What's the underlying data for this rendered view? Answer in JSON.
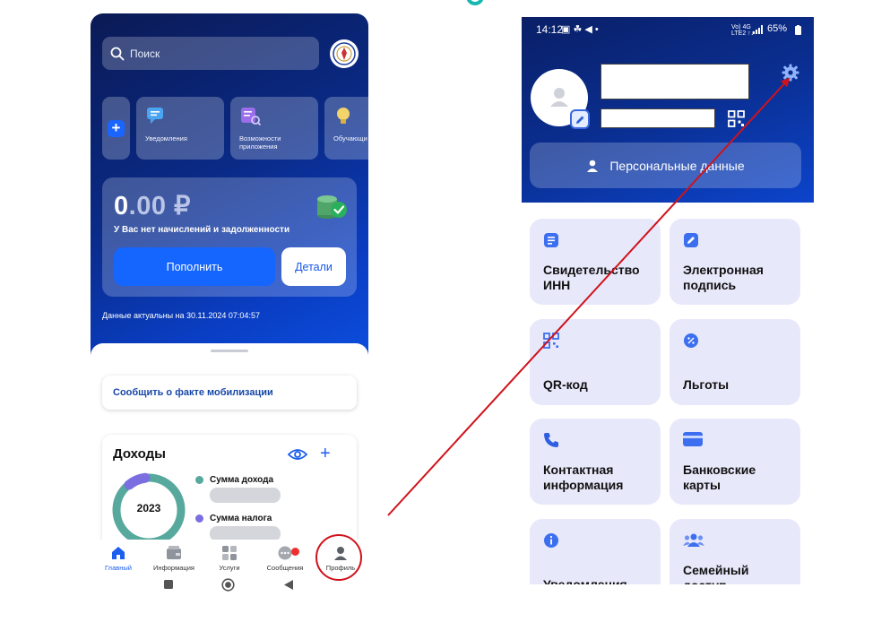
{
  "left_phone": {
    "search": {
      "placeholder": "Поиск"
    },
    "tiles": {
      "notifications": "Уведомления",
      "app_features": "Возможности приложения",
      "learning": "Обучающи"
    },
    "balance": {
      "amount_main": "0",
      "amount_dim": ".00 ₽",
      "message": "У Вас нет начислений и задолженности",
      "topup_label": "Пополнить",
      "details_label": "Детали",
      "data_date": "Данные актуальны на 30.11.2024 07:04:57"
    },
    "mobilization": {
      "label": "Сообщить о факте мобилизации"
    },
    "income": {
      "title": "Доходы",
      "year": "2023",
      "legend_income": "Сумма дохода",
      "legend_tax": "Сумма налога",
      "colors": {
        "income": "#56a99c",
        "tax": "#7b6ee0"
      }
    },
    "nav": {
      "home": "Главный",
      "info": "Информация",
      "services": "Услуги",
      "messages": "Сообщения",
      "profile": "Профиль"
    }
  },
  "right_phone": {
    "status": {
      "time": "14:12",
      "icons": "▣ ☘ ◀ •",
      "network": "Vo) 4G\nLTE2 ↑↓",
      "battery": "65%"
    },
    "personal_data": "Персональные данные",
    "cards": {
      "inn": "Свидетельство ИНН",
      "esign": "Электронная подпись",
      "qr": "QR-код",
      "benefits": "Льготы",
      "contacts": "Контактная информация",
      "bank_cards": "Банковские карты",
      "notifications": "Уведомления",
      "family": "Семейный доступ"
    }
  },
  "annotation": {
    "color": "#d0121b"
  }
}
